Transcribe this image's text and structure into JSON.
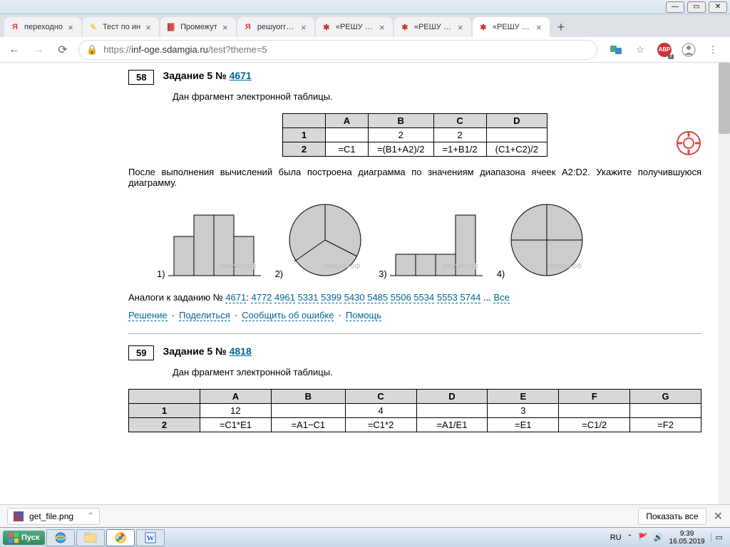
{
  "window": {
    "min": "—",
    "max": "▭",
    "close": "✕"
  },
  "tabs": [
    {
      "icon": "Я",
      "iconColor": "#f33",
      "title": "переходно"
    },
    {
      "icon": "✎",
      "iconColor": "#ec5",
      "title": "Тест по ин"
    },
    {
      "icon": "📕",
      "iconColor": "#c33",
      "title": "Промежут"
    },
    {
      "icon": "Я",
      "iconColor": "#f33",
      "title": "решуоггэ и"
    },
    {
      "icon": "✱",
      "iconColor": "#c33",
      "title": "«РЕШУ ОГ"
    },
    {
      "icon": "✱",
      "iconColor": "#c33",
      "title": "«РЕШУ ОГ"
    },
    {
      "icon": "✱",
      "iconColor": "#c33",
      "title": "«РЕШУ ОГ"
    }
  ],
  "addr": {
    "lock": "🔒",
    "prefix": "https://",
    "host": "inf-oge.sdamgia.ru",
    "path": "/test?theme=5"
  },
  "adblock": {
    "label": "ABP",
    "badge": "7"
  },
  "task58": {
    "num": "58",
    "title_prefix": "Задание 5 № ",
    "title_link": "4671",
    "intro": "Дан фраг­мент элек­трон­ной таблицы.",
    "after": "После вы­пол­не­ния вычислений была по­стро­е­на диаграмма по зна­че­ни­ям диапазона ячеек A2:D2. Укажите по­лу­чив­шу­ю­ся диаграмму.",
    "opt1": "1)",
    "opt2": "2)",
    "opt3": "3)",
    "opt4": "4)",
    "watermark": "решуогэ.рф"
  },
  "sheet58": {
    "hA": "A",
    "hB": "B",
    "hC": "C",
    "hD": "D",
    "r1": "1",
    "r2": "2",
    "b1": "2",
    "c1": "2",
    "a2": "=C1",
    "b2": "=(B1+A2)/2",
    "c2": "=1+B1/2",
    "d2": "(C1+C2)/2"
  },
  "analogs": {
    "prefix": "Аналоги к заданию № ",
    "main": "4671",
    "ids": [
      "4772",
      "4961",
      "5331",
      "5399",
      "5430",
      "5485",
      "5506",
      "5534",
      "5553",
      "5744"
    ],
    "more": "...",
    "all": "Все"
  },
  "links": {
    "solution": "Решение",
    "share": "Поделиться",
    "report": "Сообщить об ошибке",
    "help": "Помощь"
  },
  "task59": {
    "num": "59",
    "title_prefix": "Задание 5 № ",
    "title_link": "4818",
    "intro": "Дан фраг­мент элек­трон­ной таблицы."
  },
  "sheet59": {
    "hA": "A",
    "hB": "B",
    "hC": "C",
    "hD": "D",
    "hE": "E",
    "hF": "F",
    "hG": "G",
    "r1": "1",
    "r2": "2",
    "a1": "12",
    "c1": "4",
    "e1": "3",
    "a2": "=C1*E1",
    "b2": "=A1−C1",
    "c2": "=C1*2",
    "d2": "=A1/E1",
    "e2": "=E1",
    "f2": "=C1/2",
    "g2": "=F2"
  },
  "download": {
    "file": "get_file.png",
    "showall": "Показать все"
  },
  "taskbar": {
    "start": "Пуск",
    "lang": "RU",
    "time": "9:39",
    "date": "16.05.2019"
  },
  "chart_data": [
    {
      "type": "bar",
      "values": [
        2,
        3,
        3,
        2
      ],
      "note": "option 1 (short-tall-tall-short)"
    },
    {
      "type": "pie",
      "values": [
        33,
        33,
        33
      ],
      "note": "option 2 (3 roughly equal slices)"
    },
    {
      "type": "bar",
      "values": [
        1,
        1,
        1,
        3
      ],
      "note": "option 3 (three short, one tall)"
    },
    {
      "type": "pie",
      "values": [
        25,
        25,
        25,
        25
      ],
      "note": "option 4 (4 equal quarters)"
    }
  ]
}
